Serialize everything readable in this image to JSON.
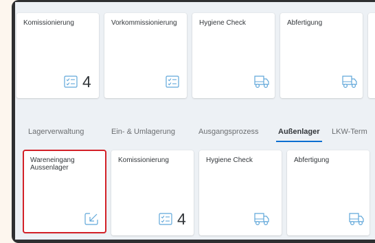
{
  "top_tiles": [
    {
      "title": "Komissionierung",
      "icon": "checklist-icon",
      "count": "4"
    },
    {
      "title": "Vorkommissionierung",
      "icon": "checklist-icon",
      "count": ""
    },
    {
      "title": "Hygiene Check",
      "icon": "truck-icon",
      "count": ""
    },
    {
      "title": "Abfertigung",
      "icon": "truck-icon",
      "count": ""
    }
  ],
  "tabs": [
    {
      "label": "Lagerverwaltung",
      "active": false
    },
    {
      "label": "Ein- & Umlagerung",
      "active": false
    },
    {
      "label": "Ausgangsprozess",
      "active": false
    },
    {
      "label": "Außenlager",
      "active": true
    },
    {
      "label": "LKW-Term",
      "active": false
    }
  ],
  "bottom_tiles": [
    {
      "title": "Wareneingang Aussenlager",
      "icon": "inbound-arrow-icon",
      "count": "",
      "highlighted": true
    },
    {
      "title": "Komissionierung",
      "icon": "checklist-icon",
      "count": "4",
      "highlighted": false
    },
    {
      "title": "Hygiene Check",
      "icon": "truck-icon",
      "count": "",
      "highlighted": false
    },
    {
      "title": "Abfertigung",
      "icon": "truck-icon",
      "count": "",
      "highlighted": false
    }
  ],
  "colors": {
    "accent": "#0a6ed1",
    "highlight": "#d32027",
    "icon": "#5fa6d9"
  }
}
